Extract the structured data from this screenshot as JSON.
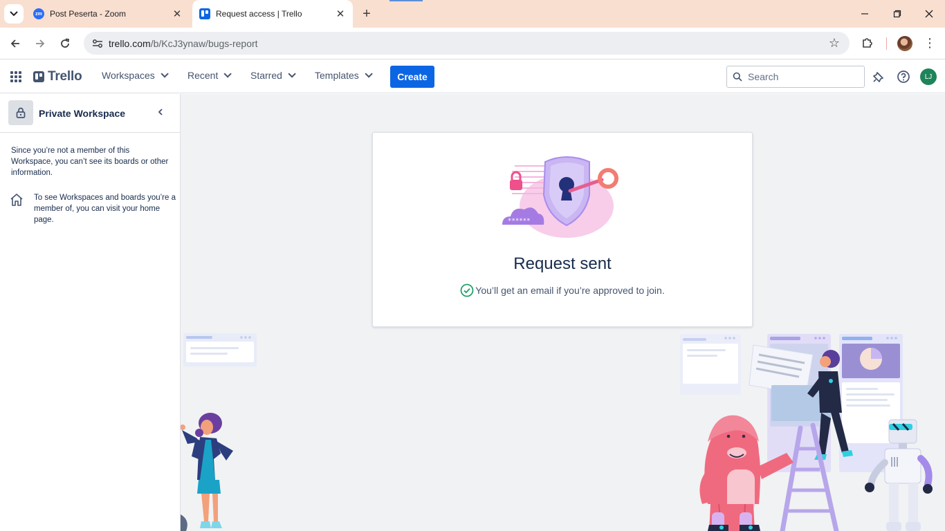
{
  "browser": {
    "tabs": [
      {
        "title": "Post Peserta - Zoom",
        "favicon": "zoom-icon"
      },
      {
        "title": "Request access | Trello",
        "favicon": "trello-icon",
        "active": true
      }
    ],
    "url_host": "trello.com",
    "url_path": "/b/KcJ3ynaw/bugs-report",
    "icons": [
      "back-icon",
      "forward-icon",
      "reload-icon",
      "site-info-icon",
      "star-icon",
      "extensions-icon",
      "kebab-menu-icon"
    ]
  },
  "header": {
    "logo": "Trello",
    "menus": [
      "Workspaces",
      "Recent",
      "Starred",
      "Templates"
    ],
    "create_label": "Create",
    "search_placeholder": "Search",
    "user_initials": "LJ",
    "colors": {
      "create_button": "#0c66e4",
      "avatar": "#1f845a"
    }
  },
  "sidebar": {
    "workspace_name": "Private Workspace",
    "not_member_text": "Since you’re not a member of this Workspace, you can’t see its boards or other information.",
    "home_text": "To see Workspaces and boards you’re a member of, you can visit your home page."
  },
  "card": {
    "title": "Request sent",
    "subtitle": "You’ll get an email if you’re approved to join.",
    "password_mask": "******",
    "colors": {
      "check": "#22a06b"
    }
  }
}
